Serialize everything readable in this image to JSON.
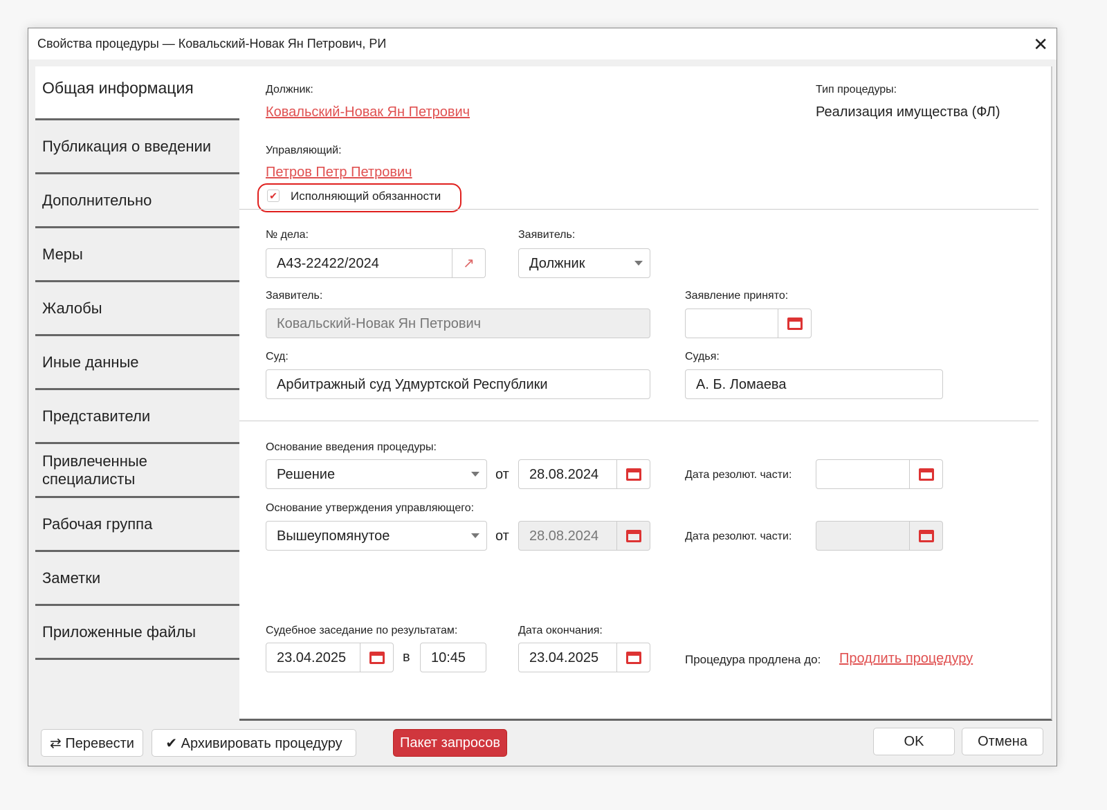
{
  "window": {
    "title": "Свойства процедуры — Ковальский-Новак Ян Петрович, РИ"
  },
  "sidebar": {
    "items": [
      {
        "label": "Общая информация"
      },
      {
        "label": "Публикация о введении"
      },
      {
        "label": "Дополнительно"
      },
      {
        "label": "Меры"
      },
      {
        "label": "Жалобы"
      },
      {
        "label": "Иные данные"
      },
      {
        "label": "Представители"
      },
      {
        "label": "Привлеченные специалисты"
      },
      {
        "label": "Рабочая группа"
      },
      {
        "label": "Заметки"
      },
      {
        "label": "Приложенные файлы"
      }
    ]
  },
  "main": {
    "debtor_label": "Должник:",
    "debtor": "Ковальский-Новак Ян Петрович",
    "type_label": "Тип процедуры:",
    "type": "Реализация имущества (ФЛ)",
    "manager_label": "Управляющий:",
    "manager": "Петров Петр Петрович",
    "acting_label": "Исполняющий обязанности",
    "case_label": "№ дела:",
    "case": "А43-22422/2024",
    "applicant_type_label": "Заявитель:",
    "applicant_type": "Должник",
    "applicant_label": "Заявитель:",
    "applicant": "Ковальский-Новак Ян Петрович",
    "accepted_label": "Заявление принято:",
    "accepted": "",
    "court_label": "Суд:",
    "court": "Арбитражный суд Удмуртской Республики",
    "judge_label": "Судья:",
    "judge": "А. Б. Ломаева",
    "basis_label": "Основание введения процедуры:",
    "basis": "Решение",
    "from": "от",
    "basis_date": "28.08.2024",
    "res_label": "Дата резолют. части:",
    "res_date1": "",
    "approval_label": "Основание утверждения управляющего:",
    "approval": "Вышеупомянутое",
    "approval_date": "28.08.2024",
    "res_date2": "",
    "hearing_label": "Судебное заседание по результатам:",
    "hearing_date": "23.04.2025",
    "at": "в",
    "hearing_time": "10:45",
    "end_label": "Дата окончания:",
    "end_date": "23.04.2025",
    "extended_label": "Процедура продлена до:",
    "extend_link": "Продлить процедуру"
  },
  "footer": {
    "translate": "⇄ Перевести",
    "archive": "✔ Архивировать процедуру",
    "requests": "Пакет запросов",
    "ok": "OK",
    "cancel": "Отмена"
  }
}
